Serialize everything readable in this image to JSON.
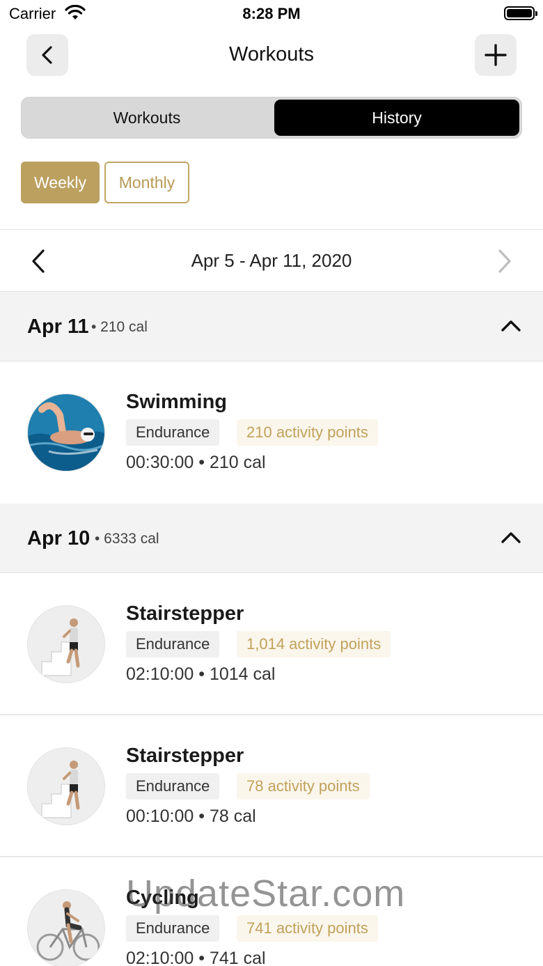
{
  "status_bar": {
    "carrier": "Carrier",
    "time": "8:28 PM"
  },
  "header": {
    "title": "Workouts"
  },
  "segment": {
    "workouts_label": "Workouts",
    "history_label": "History"
  },
  "period": {
    "weekly_label": "Weekly",
    "monthly_label": "Monthly"
  },
  "week_nav": {
    "range": "Apr 5 - Apr 11, 2020"
  },
  "days": [
    {
      "date": "Apr 11",
      "calories": "• 210 cal",
      "workouts": [
        {
          "name": "Swimming",
          "type": "Endurance",
          "points": "210 activity points",
          "stats": "00:30:00 • 210 cal"
        }
      ]
    },
    {
      "date": "Apr 10",
      "calories": "• 6333 cal",
      "workouts": [
        {
          "name": "Stairstepper",
          "type": "Endurance",
          "points": "1,014 activity points",
          "stats": "02:10:00 • 1014 cal"
        },
        {
          "name": "Stairstepper",
          "type": "Endurance",
          "points": "78 activity points",
          "stats": "00:10:00 • 78 cal"
        },
        {
          "name": "Cycling",
          "type": "Endurance",
          "points": "741 activity points",
          "stats": "02:10:00 • 741 cal"
        }
      ]
    }
  ],
  "watermark": "UpdateStar.com",
  "colors": {
    "accent_gold": "#bba05f",
    "points_text": "#c1a15b",
    "points_bg": "#fbf6ec"
  }
}
